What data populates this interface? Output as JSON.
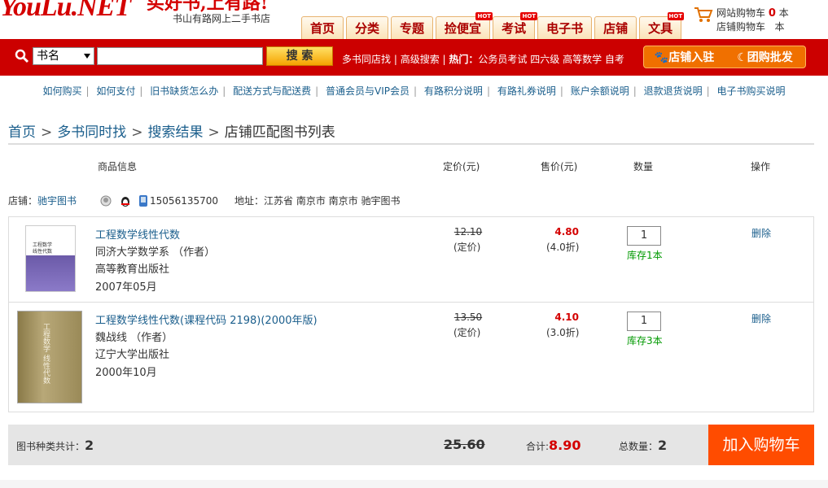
{
  "header": {
    "logo": "YouLu.NET",
    "slogan": "买好书,上有路!",
    "tagline": "书山有路网上二手书店",
    "nav_tabs": [
      {
        "label": "首页",
        "hot": ""
      },
      {
        "label": "分类",
        "hot": ""
      },
      {
        "label": "专题",
        "hot": ""
      },
      {
        "label": "捡便宜",
        "hot": "HOT"
      },
      {
        "label": "考试",
        "hot": "HOT"
      },
      {
        "label": "电子书",
        "hot": ""
      },
      {
        "label": "店铺",
        "hot": ""
      },
      {
        "label": "文具",
        "hot": "HOT"
      }
    ],
    "site_cart_label": "网站购物车",
    "site_cart_count": "0",
    "site_cart_unit": "本",
    "shop_cart_label": "店铺购物车",
    "shop_cart_unit": "本"
  },
  "search": {
    "type_selected": "书名",
    "query": "",
    "button_label": "搜 索",
    "links": [
      "多书同店找",
      "高级搜索"
    ],
    "hot_label": "热门：",
    "hot_terms": [
      "公务员考试",
      "四六级",
      "高等数学",
      "自考"
    ],
    "shop_enter_label": "店铺入驻",
    "group_buy_label": "团购批发"
  },
  "help_links": [
    "如何购买",
    "如何支付",
    "旧书缺货怎么办",
    "配送方式与配送费",
    "普通会员与VIP会员",
    "有路积分说明",
    "有路礼券说明",
    "账户余额说明",
    "退款退货说明",
    "电子书购买说明"
  ],
  "breadcrumb": {
    "home": "首页",
    "step2": "多书同时找",
    "step3": "搜索结果",
    "current": "店铺匹配图书列表",
    "sep": ">"
  },
  "table_headers": {
    "info": "商品信息",
    "list_price": "定价(元)",
    "sale_price": "售价(元)",
    "quantity": "数量",
    "action": "操作"
  },
  "shop": {
    "label": "店铺：",
    "name": "驰宇图书",
    "phone": "15056135700",
    "address_label": "地址：",
    "address": "江苏省 南京市 南京市 驰宇图书"
  },
  "items": [
    {
      "title": "工程数学线性代数",
      "author": "同济大学数学系 （作者）",
      "publisher": "高等教育出版社",
      "date": "2007年05月",
      "list_price": "12.10",
      "list_price_note": "(定价)",
      "sale_price": "4.80",
      "discount": "(4.0折)",
      "quantity": "1",
      "stock": "库存1本",
      "delete": "删除",
      "cover_text": "工程数学 线性代数"
    },
    {
      "title": "工程数学线性代数(课程代码 2198)(2000年版)",
      "author": "魏战线 （作者）",
      "publisher": "辽宁大学出版社",
      "date": "2000年10月",
      "list_price": "13.50",
      "list_price_note": "(定价)",
      "sale_price": "4.10",
      "discount": "(3.0折)",
      "quantity": "1",
      "stock": "库存3本",
      "delete": "删除",
      "cover_text": "工程数学 线性代数"
    }
  ],
  "summary": {
    "kinds_label": "图书种类共计：",
    "kinds_count": "2",
    "list_total": "25.60",
    "total_label": "合计:",
    "total": "8.90",
    "qty_label": "总数量：",
    "qty_total": "2",
    "add_to_cart": "加入购物车"
  },
  "colors": {
    "brand_red": "#cc0000",
    "link_blue": "#1a5e8c",
    "price_red": "#d40000",
    "stock_green": "#009900",
    "add_cart_orange": "#ff4c00"
  }
}
